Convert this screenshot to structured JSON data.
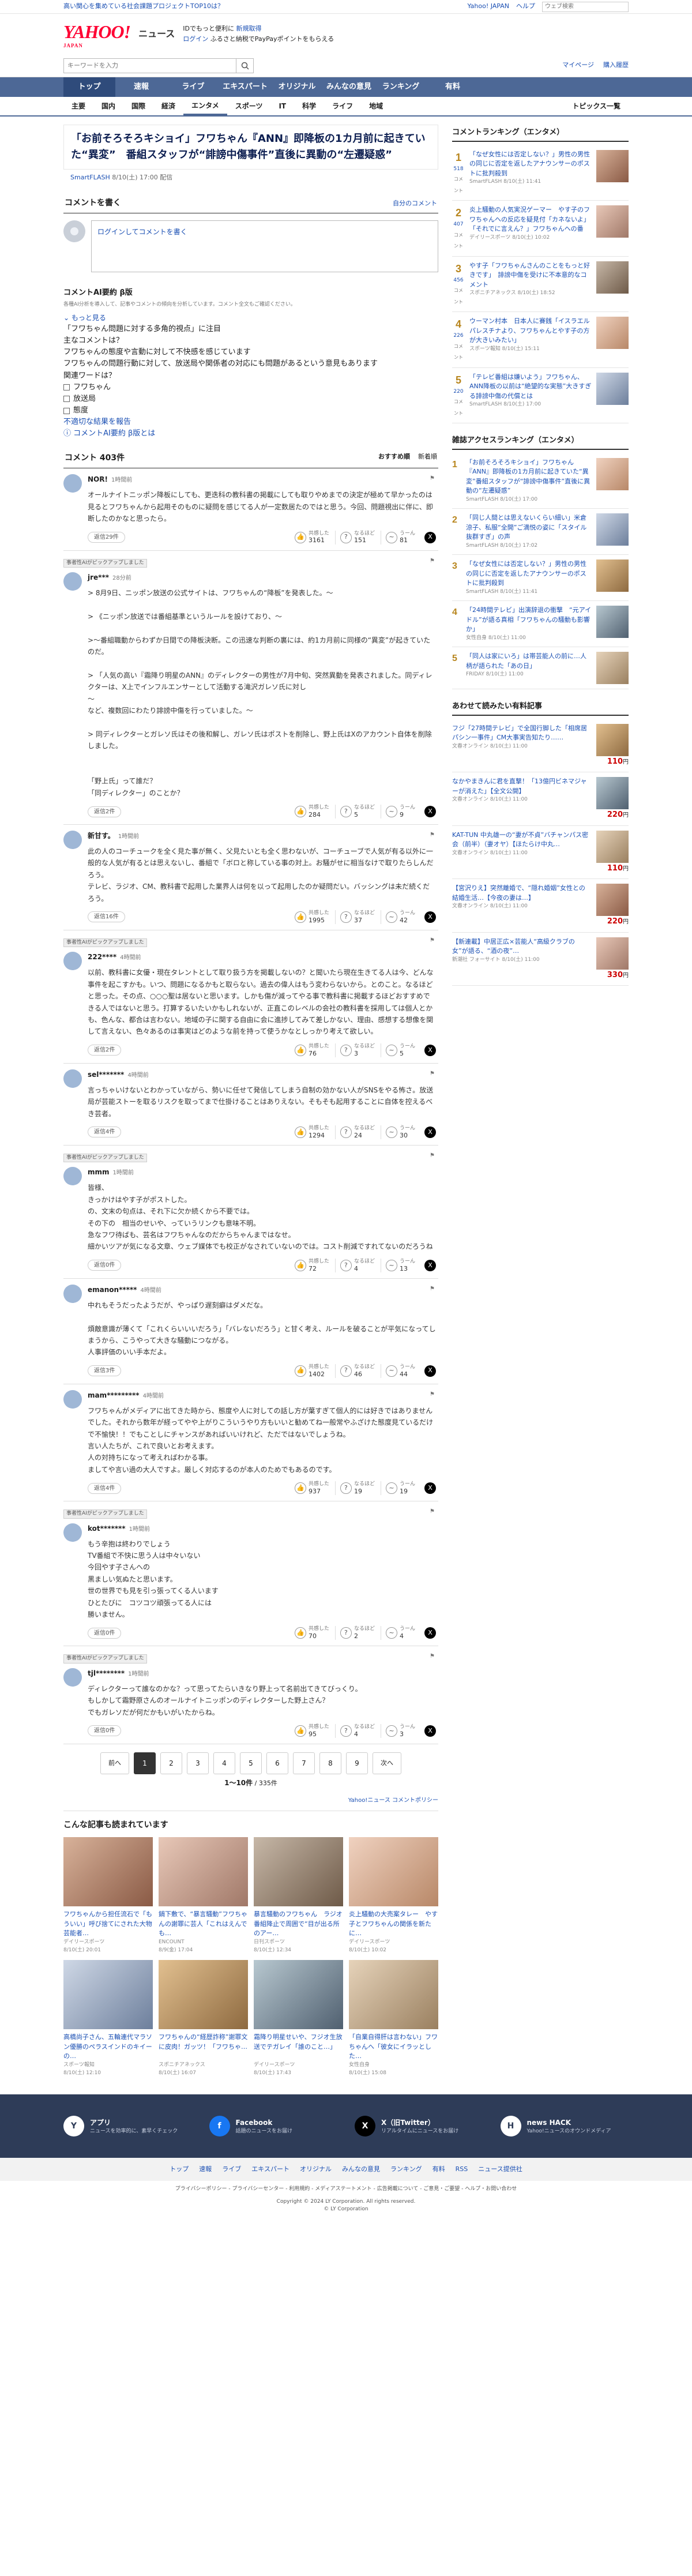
{
  "promo": {
    "text": "高い関心を集めている社会課題プロジェクトTOP10は？",
    "links": [
      "Yahoo! JAPAN",
      "ヘルプ"
    ],
    "search_placeholder": "ウェブ検索"
  },
  "masthead": {
    "logo": "YAHOO!",
    "logo_sub": "JAPAN",
    "service": "ニュース",
    "msg1": "IDでもっと便利に",
    "msg1_link": "新規取得",
    "msg2_link": "ログイン",
    "msg3": "ふるさと納税でPayPayポイントをもらえる"
  },
  "searchbar": {
    "placeholder": "キーワードを入力",
    "links": [
      "マイページ",
      "購入履歴"
    ]
  },
  "global_nav": [
    "トップ",
    "速報",
    "ライブ",
    "エキスパート",
    "オリジナル",
    "みんなの意見",
    "ランキング",
    "有料"
  ],
  "category_nav": [
    "主要",
    "国内",
    "国際",
    "経済",
    "エンタメ",
    "スポーツ",
    "IT",
    "科学",
    "ライフ",
    "地域"
  ],
  "category_topics": "トピックス一覧",
  "article": {
    "title": "「お前そろそろキショイ」フワちゃん『ANN』即降板の1カ月前に起きていた“異変”　番組スタッフが“誹謗中傷事件”直後に異動の“左遷疑惑”",
    "source": "SmartFLASH",
    "date": "8/10(土) 17:00 配信"
  },
  "comment_section": {
    "title": "コメントを書く",
    "guide_link": "自分のコメント",
    "placeholder": "ログインしてコメントを書く",
    "ai": {
      "title": "コメントAI要約",
      "badge": "β版",
      "note": "各種AI分析を導入して、記事やコメントの傾向を分析しています。コメント全文もご確認ください。",
      "more": "もっと見る",
      "lines": [
        "「フワちゃん問題に対する多角的視点」に注目",
        "主なコメントは？",
        "フワちゃんの態度や言動に対して不快感を感じています",
        "フワちゃんの問題行動に対して、放送局や関係者の対応にも問題があるという意見もあります",
        "関連ワードは？"
      ],
      "words": [
        "フワちゃん",
        "放送局",
        "態度"
      ],
      "report": "不適切な結果を報告",
      "about": "コメントAI要約 β版とは"
    },
    "count_label": "コメント 403件",
    "sort": [
      "おすすめ順",
      "新着順"
    ]
  },
  "comments": [
    {
      "pick": "",
      "name": "NOR!",
      "ago": "1時間前",
      "text": "オールナイトニッポン降板にしても、更迭科の教科書の掲載にしても取りやめまでの決定が極めて早かったのは見るとフワちゃんから起用そのものに疑問を感じてる人が一定数居たのではと思う。今回、問題視出に伴に、即断したのかなと思ったら。",
      "replies": "返信29件",
      "r1": "3161",
      "r2": "151",
      "r3": "81"
    },
    {
      "pick": "事者性AIがピックアップしました",
      "name": "jre***",
      "ago": "28分前",
      "text": "> 8月9日、ニッポン放送の公式サイトは、フワちゃんの“降板”を発表した。〜\n\n> 《ニッポン放送では番組基準というルールを設けており、〜\n\n>〜番組職動からわずか日間での降板決断。この迅速な判断の裏には、約1カ月前に同様の“異変”が起きていたのだ。\n\n> 「人気の高い『霜降り明星のANN』のディレクターの男性が7月中旬、突然異動を発表されました。同ディレクターは、X上でインフルエンサーとして活動する滝沢ガレソ氏に対し\n〜\nなど、複数回にわたり誹謗中傷を行っていました。〜\n\n> 同ディレクターとガレソ氏はその後和解し、ガレソ氏はポストを削除し、野上氏はXのアカウント自体を削除しました。\n\n\n「野上氏」って誰だ？\n「同ディレクター」のことか？",
      "replies": "返信2件",
      "r1": "284",
      "r2": "5",
      "r3": "9"
    },
    {
      "pick": "",
      "name": "新甘す。",
      "ago": "1時間前",
      "text": "此の人のコーチュークを全く見た事が無く、父見たいとも全く思わないが、コーチューブで人気が有る以外に一般的な人気が有るとは思えないし、番組で「ボロと称している事の対上。お騒がせに相当なけで取りたらしんだろう。\nテレビ、ラジオ、CM、教科書で起用した業界人は何を以って起用したのか疑問だい。バッシングは未だ続くだろう。",
      "replies": "返信16件",
      "r1": "1995",
      "r2": "37",
      "r3": "42"
    },
    {
      "pick": "事者性AIがピックアップしました",
      "name": "222****",
      "ago": "4時間前",
      "text": "以前、教科書に女優・現在タレントとして取り扱う方を掲載しないの？と聞いたら現在生きてる人は今、どんな事件を起こすかも。いつ、問題になるかもと取らない。過去の偉人はもう変わらないから。とのこと。なるほどと思った。その点、○○○聖は居ないと思います。しかも傷が減ってやる事で教科書に掲載するほどおすすめできる人ではないと思う。打算するいたいかもしれないが、正直このレベルの会社の教科書を採用しては個人とかも、色んな、都合は言わない。地域の子に関する自由に会に進捗してみて差しかない、理由、感想する想像を関して言えない、色々あるのは事実はどのような前を持って使うかなとしっかり考えて欲しい。",
      "replies": "返信2件",
      "r1": "76",
      "r2": "3",
      "r3": "5"
    },
    {
      "pick": "",
      "name": "sel*******",
      "ago": "4時間前",
      "text": "言っちゃいけないとわかっていながら、勢いに任せて発信してしまう自制の効かない人がSNSをやる怖さ。放送局が芸能ストーを取るリスクを取ってまで仕掛けることはありえない。そもそも起用することに自体を控えるべき芸者。",
      "replies": "返信4件",
      "r1": "1294",
      "r2": "24",
      "r3": "30"
    },
    {
      "pick": "事者性AIがピックアップしました",
      "name": "mmm",
      "ago": "1時間前",
      "text": "皆様、\nきっかけはやす子がポストした。\nの、文末の句点は、それ下に欠か続くから不要では。\nその下の　相当のせいや、っていうリンクも意味不明。\n急なフワ待ばも、芸名はフワちゃんなのだからちゃんまではなせ。\n細かいツアが気になる文章、ウェブ媒体でも校正がなされていないのでは。コスト削減ですれてないのだろうね",
      "replies": "返信0件",
      "r1": "72",
      "r2": "4",
      "r3": "13"
    },
    {
      "pick": "",
      "name": "emanon*****",
      "ago": "4時間前",
      "text": "中れもそうだったようだが、やっぱり遅刻癖はダメだな。\n\n煩敵意識が薄くて「これくらいいいだろう」「バレないだろう」と甘く考え、ルールを破ることが平気になってしまうから、こうやって大きな騒動につながる。\n人事評価のいい手本だよ。",
      "replies": "返信3件",
      "r1": "1402",
      "r2": "46",
      "r3": "44"
    },
    {
      "pick": "",
      "name": "mam*********",
      "ago": "4時間前",
      "text": "フワちゃんがメディアに出てきた時から、態度や人に対しての話し方が葉すぎて個人的には好きではありませんでした。それから数年が経ってやや上がりこういうやり方もいいと勧めてね一般常やふざけた態度見ているだけで不愉快！！でもことしにチャンスがあればいいけれど、ただではないでしょうね。\n言い人たちが、これで良いとお考えます。\n人の対持ちになって考えればわかる事。\nましてや言い過の大人ですよ。厳しく対応するのが本人のためでもあるのです。",
      "replies": "返信4件",
      "r1": "937",
      "r2": "19",
      "r3": "19"
    },
    {
      "pick": "事者性AIがピックアップしました",
      "name": "kot*******",
      "ago": "1時間前",
      "text": "もう辛抱は終わりでしょう\nTV番組で不快に思う人は中々いない\n今回やす子さんへの\n黒ましい気ぬたと思います。\n世の世界でも見を引っ張ってくる人います\nひとたびに　コツコツ頑張ってる人には\n勝いません。",
      "replies": "返信0件",
      "r1": "70",
      "r2": "2",
      "r3": "4"
    },
    {
      "pick": "事者性AIがピックアップしました",
      "name": "tjl********",
      "ago": "1時間前",
      "text": "ディレクターって誰なのかな？って思ってたらいきなり野上って名前出てきてびっくり。\nもしかして霜野原さんのオールナイトニッポンのディレクターした野上さん？\nでもガレソだが何だかもいがいたからね。",
      "replies": "返信0件",
      "r1": "95",
      "r2": "4",
      "r3": "3"
    }
  ],
  "reaction_labels": [
    "共感した",
    "なるほど",
    "うーん"
  ],
  "pager": {
    "prev": "前へ",
    "pages": [
      "1",
      "2",
      "3",
      "4",
      "5",
      "6",
      "7",
      "8",
      "9"
    ],
    "next": "次へ",
    "range": "1〜10件",
    "total": "335件"
  },
  "yahoo_links": "Yahoo!ニュース コメントポリシー",
  "recommended": {
    "title": "こんな記事も読まれています",
    "items": [
      {
        "title": "フワちゃんから担任流石で「もういい」呼び捨てにされた大物芸能者…",
        "src": "デイリースポーツ",
        "date": "8/10(土) 20:01"
      },
      {
        "title": "鍋下敷で、“暴言騒動”フワちゃんの謝罪に芸人「これはえんでも…",
        "src": "ENCOUNT",
        "date": "8/9(金) 17:04"
      },
      {
        "title": "暴言騒動のフワちゃん　ラジオ番組降止で周囲で“目が出る所のアー…",
        "src": "日刊スポーツ",
        "date": "8/10(土) 12:34"
      },
      {
        "title": "炎上騒動の大売案タレー　やす子とフワちゃんの関係を新たに…",
        "src": "デイリースポーツ",
        "date": "8/10(土) 10:02"
      },
      {
        "title": "高橋尚子さん、五輪連代マラソン優勝のペラスインドのキイーの…",
        "src": "スポーツ報知",
        "date": "8/10(土) 12:10"
      },
      {
        "title": "フワちゃんの“経歴詐称”謝罪文に皮肉！ガッツ！「フワちゃ…",
        "src": "スポニチアネックス",
        "date": "8/10(土) 16:07"
      },
      {
        "title": "霜降り明星せいや、フジオ生放送でテガレイ「誰のこと…」",
        "src": "デイリースポーツ",
        "date": "8/10(土) 17:43"
      },
      {
        "title": "「自業自得肝は言わない」フワちゃんへ「彼女にイラッとした…",
        "src": "女性自身",
        "date": "8/10(土) 15:08"
      }
    ]
  },
  "ranking": {
    "title": "コメントランキング（エンタメ）",
    "items": [
      {
        "num": "1",
        "count": "518",
        "unit": "コメント",
        "title": "「なぜ女性には否定しない？」男性の男性の同じに否定を返したアナウンサーのポストに批判殺到",
        "meta": "SmartFLASH 8/10(土) 11:41"
      },
      {
        "num": "2",
        "count": "407",
        "unit": "コメント",
        "title": "炎上騒動の人気実況ゲーマー　やす子のフワちゃんへの反応を疑見付「カネないよ」「それでに言えん？」フワちゃんへの番",
        "meta": "デイリースポーツ 8/10(土) 10:02"
      },
      {
        "num": "3",
        "count": "456",
        "unit": "コメント",
        "title": "やす子「フワちゃんさんのことをもっと好きです」　誹謗中傷を受けに不本意的なコメント",
        "meta": "スポニチアネックス 8/10(土) 18:52"
      },
      {
        "num": "4",
        "count": "226",
        "unit": "コメント",
        "title": "ウーマン村本　日本人に賽銭「イスラエルパレスチナより、フワちゃんとやす子の方が大きいみたい」",
        "meta": "スポーツ報知 8/10(土) 15:11"
      },
      {
        "num": "5",
        "count": "220",
        "unit": "コメント",
        "title": "「テレビ番組は嫌いよう」フワちゃん、ANN降板の以前は“絶望的な実態”大きすぎる誹謗中傷の代償とは",
        "meta": "SmartFLASH 8/10(土) 17:00"
      }
    ]
  },
  "access": {
    "title": "雑誌アクセスランキング（エンタメ）",
    "items": [
      {
        "num": "1",
        "title": "「お前そろそろキショイ」フワちゃん『ANN』即降板の1カ月前に起きていた“異変”番組スタッフが“誹謗中傷事件”直後に異動の“左遷疑惑”",
        "meta": "SmartFLASH 8/10(土) 17:00"
      },
      {
        "num": "2",
        "title": "「同じ人間とは思えないくらい細い」米倉涼子、私服“全開”ご満悦の姿に「スタイル抜群すぎ」の声",
        "meta": "SmartFLASH 8/10(土) 17:02"
      },
      {
        "num": "3",
        "title": "「なぜ女性には否定しない？」男性の男性の同じに否定を返したアナウンサーのポストに批判殺到",
        "meta": "SmartFLASH 8/10(土) 11:41"
      },
      {
        "num": "4",
        "title": "「24時間テレビ」出演辞退の衝撃　“元アイドル”が語る真相「フワちゃんの騒動も影響か」",
        "meta": "女性自身 8/10(土) 11:00"
      },
      {
        "num": "5",
        "title": "「同人は家にいろ」は帯芸能人の前に…人柄が語られた「あの日」",
        "meta": "FRIDAY 8/10(土) 11:00"
      }
    ]
  },
  "shopping": {
    "title": "あわせて読みたい有料記事",
    "items": [
      {
        "title": "フジ「27時間テレビ」で全国行脚した「相席居パシン一事件」CM大事実告知たり……",
        "meta": "文春オンライン 8/10(土) 11:00",
        "price": "110",
        "unit": "円"
      },
      {
        "title": "なかやまきんに君を直撃！「13億円ビネマジャーが消えた」【全文公開】",
        "meta": "文春オンライン 8/10(土) 11:00",
        "price": "220",
        "unit": "円"
      },
      {
        "title": "KAT-TUN 中丸雄一の“妻が不貞”バチャンパス密会（前半）（妻オヤ）【ほたらけ中丸…",
        "meta": "文春オンライン 8/10(土) 11:00",
        "price": "110",
        "unit": "円"
      },
      {
        "title": "【宮沢りえ】突然離婚で、“隠れ婚姻”女性との結婚生活…【今夜の妻は…】",
        "meta": "文春オンライン 8/10(土) 11:00",
        "price": "220",
        "unit": "円"
      },
      {
        "title": "【新連載】中居正広×芸能人“高級クラブの女”が語る、“酒の夜”…",
        "meta": "新潮社 フォーサイト 8/10(土) 11:00",
        "price": "330",
        "unit": "円"
      }
    ]
  },
  "footer": {
    "blocks": [
      {
        "icon": "app-icon",
        "glyph": "Y",
        "title": "アプリ",
        "desc": "ニュースを効率的に、素早くチェック"
      },
      {
        "icon": "facebook-icon",
        "glyph": "f",
        "title": "Facebook",
        "desc": "話題のニュースをお届け"
      },
      {
        "icon": "x-icon",
        "glyph": "X",
        "title": "X（旧Twitter）",
        "desc": "リアルタイムにニュースをお届け"
      },
      {
        "icon": "hack-icon",
        "glyph": "H",
        "title": "news HACK",
        "desc": "Yahoo!ニュースのオウンドメディア"
      }
    ],
    "nav": [
      "トップ",
      "速報",
      "ライブ",
      "エキスパート",
      "オリジナル",
      "みんなの意見",
      "ランキング",
      "有料",
      "RSS",
      "ニュース提供社"
    ],
    "nav2": "プライバシーポリシー - プライバシーセンター - 利用規約 - メディアステートメント - 広告掲載について - ご意見・ご要望 - ヘルプ・お問い合わせ",
    "copy1": "Copyright © 2024 LY Corporation. All rights reserved.",
    "copy2": "© LY Corporation"
  },
  "colors": {
    "nav": "#4d6896",
    "nav_active": "#2f4b7b",
    "brand": "#ff0033",
    "link": "#1a4fb3",
    "rank_gold": "#b8861e"
  }
}
